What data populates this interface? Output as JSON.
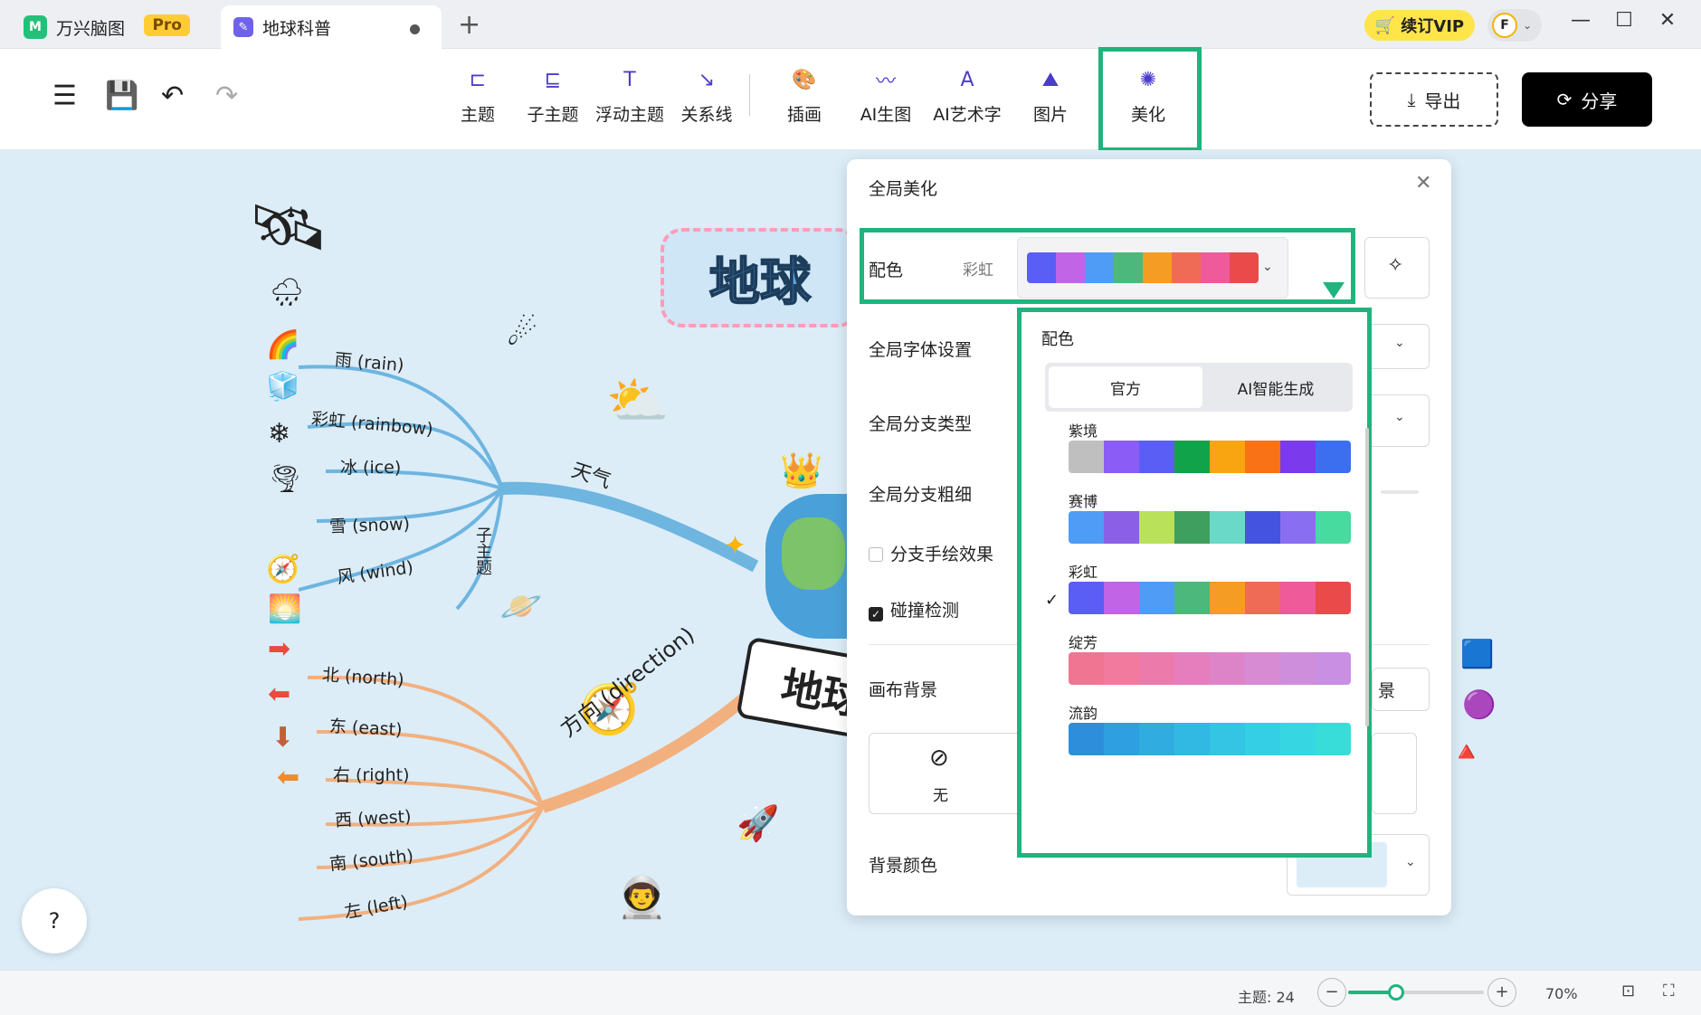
{
  "tabs": {
    "app_title": "万兴脑图",
    "app_badge": "Pro",
    "doc_title": "地球科普",
    "new_tab": "+"
  },
  "titlebar": {
    "vip_label": "续订VIP",
    "avatar_letter": "F",
    "minimize": "—",
    "maximize": "☐",
    "close": "✕"
  },
  "toolbar": {
    "tools": [
      "主题",
      "子主题",
      "浮动主题",
      "关系线",
      "插画",
      "AI生图",
      "AI艺术字",
      "图片",
      "美化"
    ],
    "export_label": "导出",
    "share_label": "分享"
  },
  "mindmap": {
    "center_title": "地球",
    "center_banner": "地球",
    "weather_branch": "天气",
    "weather_subtopic": "子主题",
    "weather_items": [
      "雨 (rain)",
      "彩虹 (rainbow)",
      "冰 (ice)",
      "雪 (snow)",
      "风 (wind)"
    ],
    "direction_branch": "方向 (direction)",
    "direction_items": [
      "北 (north)",
      "东 (east)",
      "右 (right)",
      "西 (west)",
      "南 (south)",
      "左 (left)"
    ]
  },
  "panel": {
    "title": "全局美化",
    "color_label": "配色",
    "color_value": "彩虹",
    "font_label": "全局字体设置",
    "branch_type_label": "全局分支类型",
    "branch_width_label": "全局分支粗细",
    "hand_drawn_label": "分支手绘效果",
    "hand_drawn_checked": false,
    "collision_label": "碰撞检测",
    "collision_checked": true,
    "canvas_bg_label": "画布背景",
    "bg_none_label": "无",
    "bg_partial_label": "景",
    "bg_color_label": "背景颜色",
    "rainbow_colors": [
      "#5b5ef4",
      "#c165e6",
      "#4e9cf5",
      "#4cb87c",
      "#f49c24",
      "#ef6b55",
      "#ee5a9a",
      "#ea4a4a"
    ]
  },
  "dropdown": {
    "title": "配色",
    "tab_official": "官方",
    "tab_ai": "AI智能生成",
    "selected": "彩虹",
    "schemes": [
      {
        "name": "紫境",
        "colors": [
          "#bfbfbf",
          "#8b5cf6",
          "#5b5ef4",
          "#11a34a",
          "#f9a512",
          "#f97316",
          "#7c3aed",
          "#3b6ff0"
        ]
      },
      {
        "name": "赛博",
        "colors": [
          "#4e9cf5",
          "#8b5fe6",
          "#b9e15a",
          "#3f9f5f",
          "#6ad9c8",
          "#4453e0",
          "#8a6ef2",
          "#47dba0"
        ]
      },
      {
        "name": "彩虹",
        "colors": [
          "#5b5ef4",
          "#c165e6",
          "#4e9cf5",
          "#4cb87c",
          "#f49c24",
          "#ef6b55",
          "#ee5a9a",
          "#ea4a4a"
        ]
      },
      {
        "name": "绽芳",
        "colors": [
          "#ef7593",
          "#f27a9e",
          "#ec7aab",
          "#e67ebd",
          "#dd84c8",
          "#d68bd3",
          "#cf8edb",
          "#c88fe3"
        ]
      },
      {
        "name": "流韵",
        "colors": [
          "#2d8fdb",
          "#2e9fe0",
          "#30ace0",
          "#31b9e3",
          "#33c5e3",
          "#34cfe4",
          "#36d7e3",
          "#38dcd8"
        ]
      }
    ]
  },
  "statusbar": {
    "topic_count": "主题: 24",
    "zoom_out": "−",
    "zoom_in": "+",
    "zoom": "70%",
    "zoom_fraction": 0.35
  }
}
